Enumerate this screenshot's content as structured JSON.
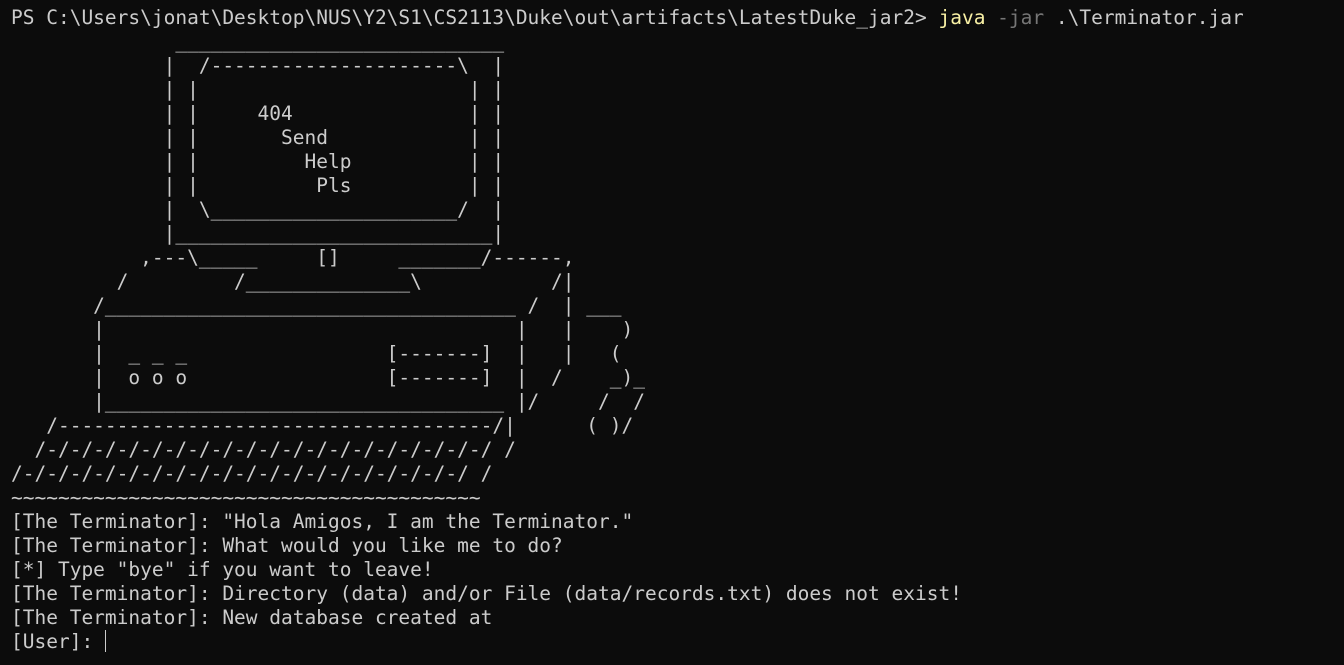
{
  "prompt": {
    "path_prompt": "PS C:\\Users\\jonat\\Desktop\\NUS\\Y2\\S1\\CS2113\\Duke\\out\\artifacts\\LatestDuke_jar2> ",
    "command": "java",
    "flag": " -jar",
    "argument": " .\\Terminator.jar"
  },
  "ascii_art": [
    "              ____________________________",
    "             |  /---------------------\\  |",
    "             | |                       | |",
    "             | |     404               | |",
    "             | |       Send            | |",
    "             | |         Help          | |",
    "             | |          Pls          | |",
    "             |  \\_____________________/  |",
    "             |___________________________|",
    "           ,---\\_____     []     _______/------,",
    "         /         /______________\\           /|",
    "       /___________________________________ /  | ___",
    "       |                                   |   |    )",
    "       |  _ _ _                 [-------]  |   |   (",
    "       |  o o o                 [-------]  |  /    _)_",
    "       |__________________________________ |/     /  /",
    "   /-------------------------------------/|      ( )/",
    "  /-/-/-/-/-/-/-/-/-/-/-/-/-/-/-/-/-/-/-/ /",
    "/-/-/-/-/-/-/-/-/-/-/-/-/-/-/-/-/-/-/-/ /",
    "~~~~~~~~~~~~~~~~~~~~~~~~~~~~~~~~~~~~~~~~"
  ],
  "messages": [
    "[The Terminator]: \"Hola Amigos, I am the Terminator.\"",
    "[The Terminator]: What would you like me to do?",
    "[*] Type \"bye\" if you want to leave!",
    "[The Terminator]: Directory (data) and/or File (data/records.txt) does not exist!",
    "[The Terminator]: New database created at"
  ],
  "input": {
    "label": "[User]: "
  }
}
